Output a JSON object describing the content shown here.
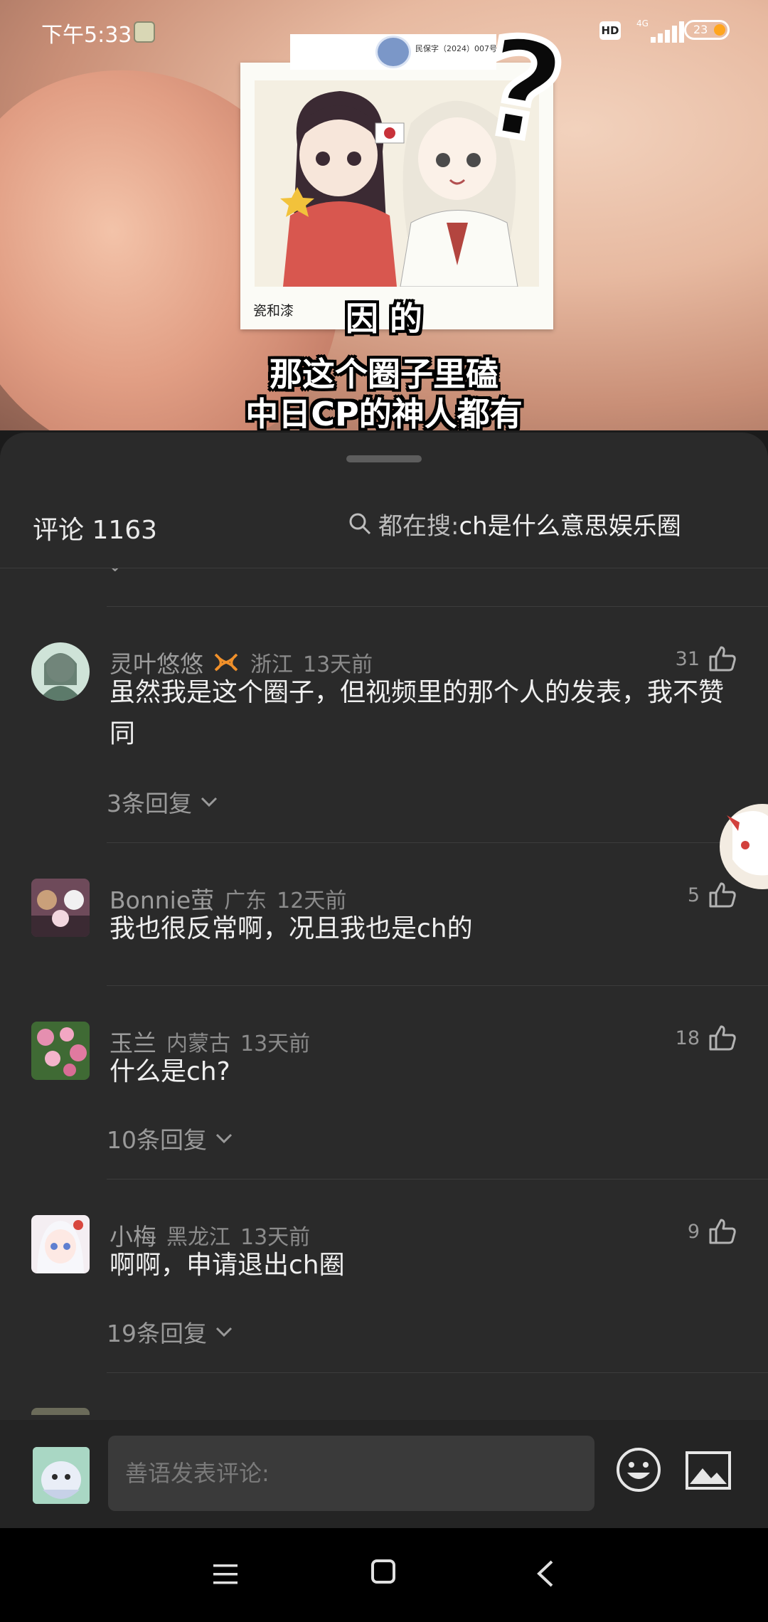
{
  "status_bar": {
    "time": "下午5:33",
    "network": "4G",
    "battery": "23"
  },
  "video": {
    "doc_number": "民保字（2024）007号",
    "card_title": "瓷和漆",
    "caption_top": "因                                              的",
    "caption_line1": "那这个圈子里磕",
    "caption_line2": "中日CP的神人都有"
  },
  "comments_header": {
    "title": "评论 1163",
    "search_prefix": "都在搜:",
    "search_query": "ch是什么意思娱乐圈"
  },
  "comments": [
    {
      "username": "灵叶悠悠",
      "has_badge": true,
      "location": "浙江",
      "time": "13天前",
      "likes": "31",
      "text": "虽然我是这个圈子，但视频里的那个人的发表，我不赞同",
      "replies": "3条回复"
    },
    {
      "username": "Bonnie萤",
      "has_badge": false,
      "location": "广东",
      "time": "12天前",
      "likes": "5",
      "text": "我也很反常啊，况且我也是ch的",
      "replies": ""
    },
    {
      "username": "玉兰",
      "has_badge": false,
      "location": "内蒙古",
      "time": "13天前",
      "likes": "18",
      "text": "什么是ch?",
      "replies": "10条回复"
    },
    {
      "username": "小梅",
      "has_badge": false,
      "location": "黑龙江",
      "time": "13天前",
      "likes": "9",
      "text": "啊啊，申请退出ch圈",
      "replies": "19条回复"
    }
  ],
  "input_bar": {
    "placeholder": "善语发表评论:"
  },
  "colors": {
    "sheet_bg": "#2a2a2a",
    "badge": "#f0902a",
    "text": "#efefef",
    "muted": "#8b8b8b"
  }
}
